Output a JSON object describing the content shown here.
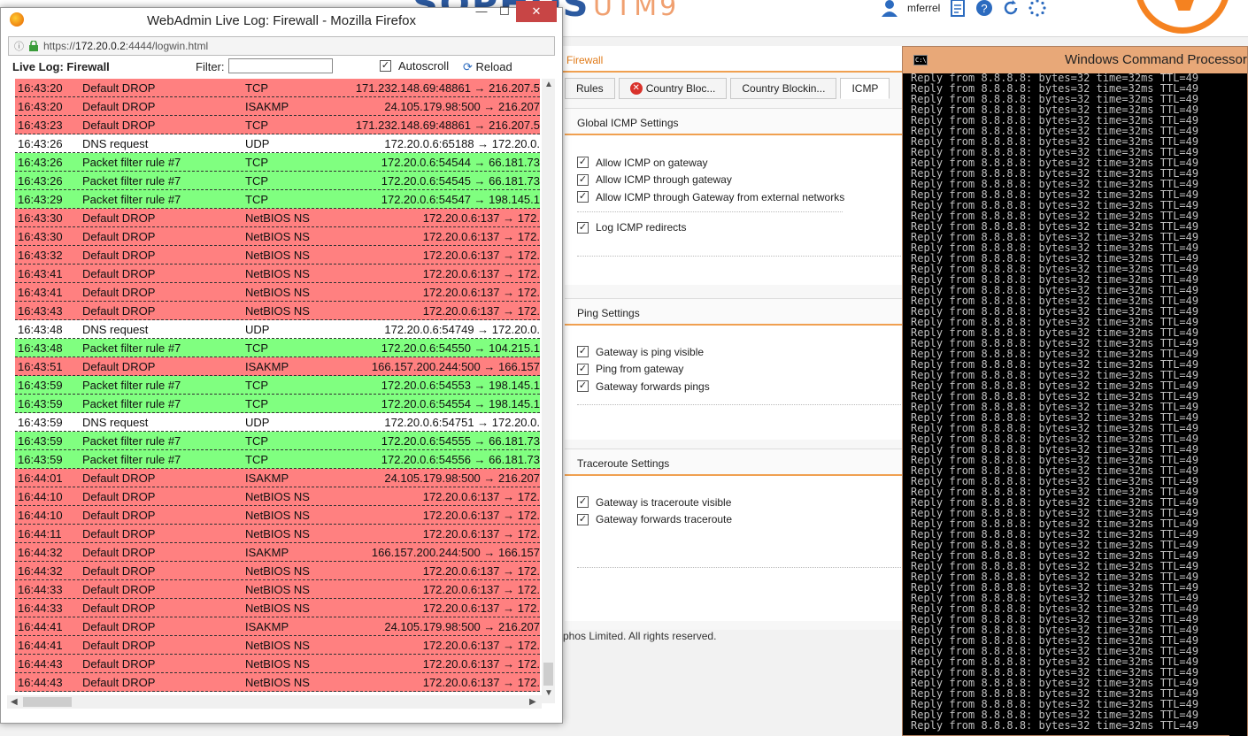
{
  "header": {
    "username": "mferrel"
  },
  "webadmin": {
    "breadcrumb": "Firewall",
    "tabs": [
      {
        "label": "Rules"
      },
      {
        "label": "Country Bloc..."
      },
      {
        "label": "Country Blockin..."
      },
      {
        "label": "ICMP"
      }
    ],
    "sections": [
      {
        "title": "Global ICMP Settings",
        "options": [
          {
            "label": "Allow ICMP on gateway",
            "checked": true
          },
          {
            "label": "Allow ICMP through gateway",
            "checked": true
          },
          {
            "label": "Allow ICMP through Gateway from external networks",
            "checked": true
          },
          {
            "label": "Log ICMP redirects",
            "checked": true
          }
        ]
      },
      {
        "title": "Ping Settings",
        "options": [
          {
            "label": "Gateway is ping visible",
            "checked": true
          },
          {
            "label": "Ping from gateway",
            "checked": true
          },
          {
            "label": "Gateway forwards pings",
            "checked": true
          }
        ]
      },
      {
        "title": "Traceroute Settings",
        "options": [
          {
            "label": "Gateway is traceroute visible",
            "checked": true
          },
          {
            "label": "Gateway forwards traceroute",
            "checked": true
          }
        ]
      }
    ],
    "copyright": "phos Limited. All rights reserved."
  },
  "firefox": {
    "title": "WebAdmin Live Log: Firewall - Mozilla Firefox",
    "url_prefix": "https://",
    "url_host": "172.20.0.2",
    "url_rest": ":4444/logwin.html",
    "live_log_label": "Live Log: Firewall",
    "filter_label": "Filter:",
    "filter_value": "",
    "autoscroll_label": "Autoscroll",
    "autoscroll_checked": true,
    "reload_label": "Reload"
  },
  "log_rows": [
    {
      "time": "16:43:20",
      "action": "Default DROP",
      "proto": "TCP",
      "addr": "171.232.148.69:48861 → 216.207.5",
      "color": "red"
    },
    {
      "time": "16:43:20",
      "action": "Default DROP",
      "proto": "ISAKMP",
      "addr": "24.105.179.98:500 → 216.207",
      "color": "red"
    },
    {
      "time": "16:43:23",
      "action": "Default DROP",
      "proto": "TCP",
      "addr": "171.232.148.69:48861 → 216.207.5",
      "color": "red"
    },
    {
      "time": "16:43:26",
      "action": "DNS request",
      "proto": "UDP",
      "addr": "172.20.0.6:65188 → 172.20.0.",
      "color": "white"
    },
    {
      "time": "16:43:26",
      "action": "Packet filter rule #7",
      "proto": "TCP",
      "addr": "172.20.0.6:54544 → 66.181.73",
      "color": "green"
    },
    {
      "time": "16:43:26",
      "action": "Packet filter rule #7",
      "proto": "TCP",
      "addr": "172.20.0.6:54545 → 66.181.73",
      "color": "green"
    },
    {
      "time": "16:43:29",
      "action": "Packet filter rule #7",
      "proto": "TCP",
      "addr": "172.20.0.6:54547 → 198.145.1",
      "color": "green"
    },
    {
      "time": "16:43:30",
      "action": "Default DROP",
      "proto": "NetBIOS NS",
      "addr": "172.20.0.6:137 → 172.",
      "color": "red"
    },
    {
      "time": "16:43:30",
      "action": "Default DROP",
      "proto": "NetBIOS NS",
      "addr": "172.20.0.6:137 → 172.",
      "color": "red"
    },
    {
      "time": "16:43:32",
      "action": "Default DROP",
      "proto": "NetBIOS NS",
      "addr": "172.20.0.6:137 → 172.",
      "color": "red"
    },
    {
      "time": "16:43:41",
      "action": "Default DROP",
      "proto": "NetBIOS NS",
      "addr": "172.20.0.6:137 → 172.",
      "color": "red"
    },
    {
      "time": "16:43:41",
      "action": "Default DROP",
      "proto": "NetBIOS NS",
      "addr": "172.20.0.6:137 → 172.",
      "color": "red"
    },
    {
      "time": "16:43:43",
      "action": "Default DROP",
      "proto": "NetBIOS NS",
      "addr": "172.20.0.6:137 → 172.",
      "color": "red"
    },
    {
      "time": "16:43:48",
      "action": "DNS request",
      "proto": "UDP",
      "addr": "172.20.0.6:54749 → 172.20.0.",
      "color": "white"
    },
    {
      "time": "16:43:48",
      "action": "Packet filter rule #7",
      "proto": "TCP",
      "addr": "172.20.0.6:54550 → 104.215.1",
      "color": "green"
    },
    {
      "time": "16:43:51",
      "action": "Default DROP",
      "proto": "ISAKMP",
      "addr": "166.157.200.244:500 → 166.157",
      "color": "red"
    },
    {
      "time": "16:43:59",
      "action": "Packet filter rule #7",
      "proto": "TCP",
      "addr": "172.20.0.6:54553 → 198.145.1",
      "color": "green"
    },
    {
      "time": "16:43:59",
      "action": "Packet filter rule #7",
      "proto": "TCP",
      "addr": "172.20.0.6:54554 → 198.145.1",
      "color": "green"
    },
    {
      "time": "16:43:59",
      "action": "DNS request",
      "proto": "UDP",
      "addr": "172.20.0.6:54751 → 172.20.0.",
      "color": "white"
    },
    {
      "time": "16:43:59",
      "action": "Packet filter rule #7",
      "proto": "TCP",
      "addr": "172.20.0.6:54555 → 66.181.73",
      "color": "green"
    },
    {
      "time": "16:43:59",
      "action": "Packet filter rule #7",
      "proto": "TCP",
      "addr": "172.20.0.6:54556 → 66.181.73",
      "color": "green"
    },
    {
      "time": "16:44:01",
      "action": "Default DROP",
      "proto": "ISAKMP",
      "addr": "24.105.179.98:500 → 216.207",
      "color": "red"
    },
    {
      "time": "16:44:10",
      "action": "Default DROP",
      "proto": "NetBIOS NS",
      "addr": "172.20.0.6:137 → 172.",
      "color": "red"
    },
    {
      "time": "16:44:10",
      "action": "Default DROP",
      "proto": "NetBIOS NS",
      "addr": "172.20.0.6:137 → 172.",
      "color": "red"
    },
    {
      "time": "16:44:11",
      "action": "Default DROP",
      "proto": "NetBIOS NS",
      "addr": "172.20.0.6:137 → 172.",
      "color": "red"
    },
    {
      "time": "16:44:32",
      "action": "Default DROP",
      "proto": "ISAKMP",
      "addr": "166.157.200.244:500 → 166.157",
      "color": "red"
    },
    {
      "time": "16:44:32",
      "action": "Default DROP",
      "proto": "NetBIOS NS",
      "addr": "172.20.0.6:137 → 172.",
      "color": "red"
    },
    {
      "time": "16:44:33",
      "action": "Default DROP",
      "proto": "NetBIOS NS",
      "addr": "172.20.0.6:137 → 172.",
      "color": "red"
    },
    {
      "time": "16:44:33",
      "action": "Default DROP",
      "proto": "NetBIOS NS",
      "addr": "172.20.0.6:137 → 172.",
      "color": "red"
    },
    {
      "time": "16:44:41",
      "action": "Default DROP",
      "proto": "ISAKMP",
      "addr": "24.105.179.98:500 → 216.207",
      "color": "red"
    },
    {
      "time": "16:44:41",
      "action": "Default DROP",
      "proto": "NetBIOS NS",
      "addr": "172.20.0.6:137 → 172.",
      "color": "red"
    },
    {
      "time": "16:44:43",
      "action": "Default DROP",
      "proto": "NetBIOS NS",
      "addr": "172.20.0.6:137 → 172.",
      "color": "red"
    },
    {
      "time": "16:44:43",
      "action": "Default DROP",
      "proto": "NetBIOS NS",
      "addr": "172.20.0.6:137 → 172.",
      "color": "red"
    }
  ],
  "cmd": {
    "title": "Windows Command Processor -",
    "line": "Reply from 8.8.8.8: bytes=32 time=32ms TTL=49",
    "line_count": 62
  },
  "colors": {
    "log_red": "#ff8080",
    "log_green": "#80ff80",
    "accent_orange": "#f58220",
    "brand_blue": "#2c5aa0"
  }
}
